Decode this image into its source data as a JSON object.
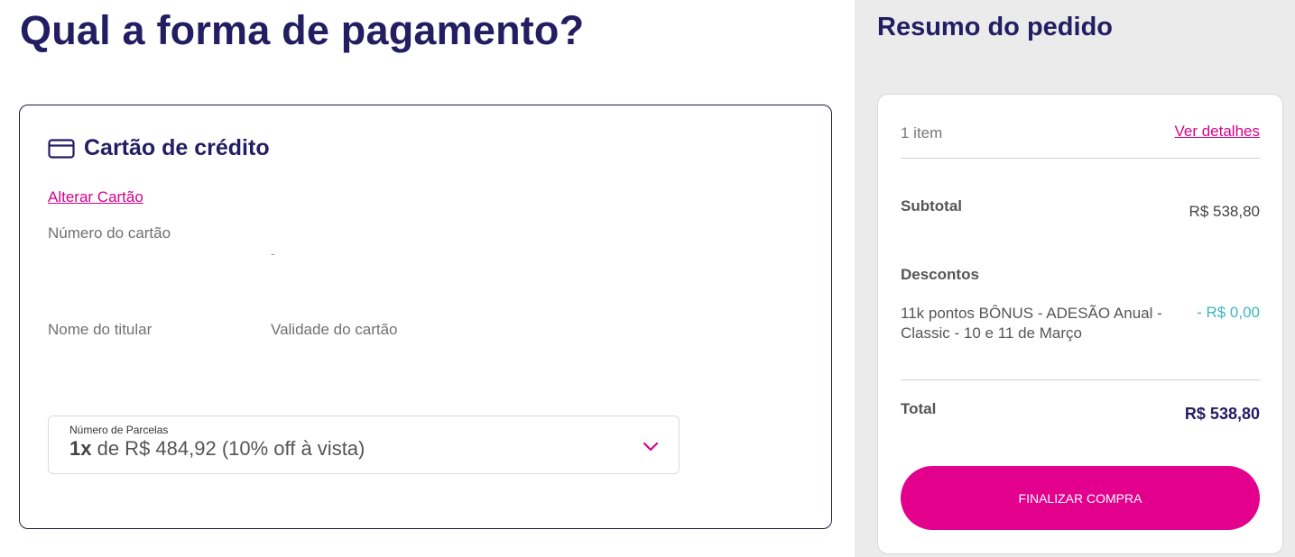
{
  "page": {
    "title": "Qual a forma de pagamento?"
  },
  "payment": {
    "method_label": "Cartão de crédito",
    "change_card_label": "Alterar Cartão",
    "card_number_label": "Número do cartão",
    "card_number_mask": "-",
    "holder_name_label": "Nome do titular",
    "expiry_label": "Validade do cartão",
    "installments": {
      "label": "Número de Parcelas",
      "selected_count": "1x",
      "selected_rest": " de R$ 484,92 (10% off à vista)"
    }
  },
  "summary": {
    "title": "Resumo do pedido",
    "items_count": "1 item",
    "details_link": "Ver detalhes",
    "subtotal_label": "Subtotal",
    "subtotal_value": "R$ 538,80",
    "discounts_label": "Descontos",
    "discount_item": "11k pontos BÔNUS - ADESÃO Anual - Classic - 10 e 11 de Março",
    "discount_value": "- R$ 0,00",
    "total_label": "Total",
    "total_value": "R$ 538,80",
    "finalize_button": "FINALIZAR COMPRA"
  },
  "colors": {
    "brand_navy": "#231d62",
    "accent_magenta": "#e2008d",
    "discount_teal": "#3cb6c2",
    "summary_background": "#ebebeb"
  },
  "icons": {
    "payment_method": "credit-card-icon",
    "installments_dropdown": "chevron-down-icon"
  }
}
